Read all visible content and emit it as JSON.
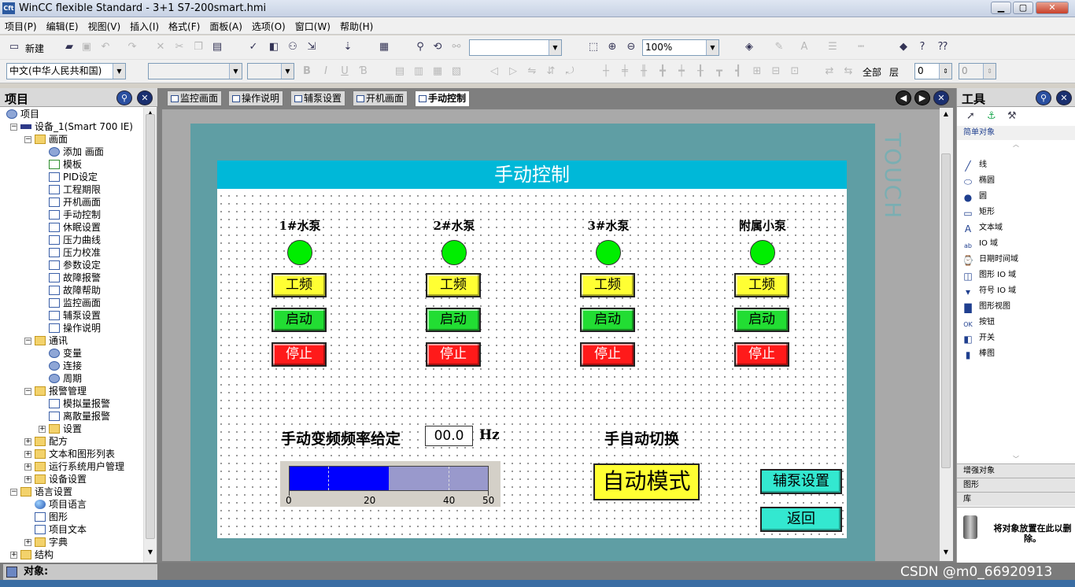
{
  "window": {
    "icon_text": "Cft",
    "title": "WinCC flexible Standard - 3+1 S7-200smart.hmi",
    "min": "▁",
    "max": "▢",
    "close": "✕"
  },
  "menu": [
    "项目(P)",
    "编辑(E)",
    "视图(V)",
    "插入(I)",
    "格式(F)",
    "面板(A)",
    "选项(O)",
    "窗口(W)",
    "帮助(H)"
  ],
  "toolbar": {
    "new_label": "新建",
    "zoom": "100%",
    "language": "中文(中华人民共和国)",
    "all_label": "全部",
    "layer_label": "层",
    "layer_value": "0",
    "layer_value2": "0"
  },
  "project_pane": {
    "title": "项目",
    "items": [
      {
        "label": "项目",
        "icon": "project-icon"
      },
      {
        "label": "设备_1(Smart 700 IE)",
        "icon": "device-icon"
      },
      {
        "label": "画面",
        "icon": "folder-icon"
      },
      {
        "label": "添加 画面",
        "icon": "add-screen-icon"
      },
      {
        "label": "模板",
        "icon": "template-icon"
      },
      {
        "label": "PID设定",
        "icon": "screen-icon"
      },
      {
        "label": "工程期限",
        "icon": "screen-icon"
      },
      {
        "label": "开机画面",
        "icon": "screen-icon"
      },
      {
        "label": "手动控制",
        "icon": "screen-icon"
      },
      {
        "label": "休眠设置",
        "icon": "screen-icon"
      },
      {
        "label": "压力曲线",
        "icon": "screen-icon"
      },
      {
        "label": "压力校准",
        "icon": "screen-icon"
      },
      {
        "label": "参数设定",
        "icon": "screen-icon"
      },
      {
        "label": "故障报警",
        "icon": "screen-icon"
      },
      {
        "label": "故障帮助",
        "icon": "screen-icon"
      },
      {
        "label": "监控画面",
        "icon": "screen-icon"
      },
      {
        "label": "辅泵设置",
        "icon": "screen-icon"
      },
      {
        "label": "操作说明",
        "icon": "screen-icon"
      },
      {
        "label": "通讯",
        "icon": "folder-icon"
      },
      {
        "label": "变量",
        "icon": "tag-icon"
      },
      {
        "label": "连接",
        "icon": "connection-icon"
      },
      {
        "label": "周期",
        "icon": "cycle-icon"
      },
      {
        "label": "报警管理",
        "icon": "folder-icon"
      },
      {
        "label": "模拟量报警",
        "icon": "analog-alarm-icon"
      },
      {
        "label": "离散量报警",
        "icon": "discrete-alarm-icon"
      },
      {
        "label": "设置",
        "icon": "folder-icon"
      },
      {
        "label": "配方",
        "icon": "folder-icon"
      },
      {
        "label": "文本和图形列表",
        "icon": "folder-icon"
      },
      {
        "label": "运行系统用户管理",
        "icon": "folder-icon"
      },
      {
        "label": "设备设置",
        "icon": "folder-icon"
      },
      {
        "label": "语言设置",
        "icon": "folder-icon"
      },
      {
        "label": "项目语言",
        "icon": "globe-icon"
      },
      {
        "label": "图形",
        "icon": "graphics-icon"
      },
      {
        "label": "项目文本",
        "icon": "text-icon"
      },
      {
        "label": "字典",
        "icon": "folder-icon"
      },
      {
        "label": "结构",
        "icon": "folder-icon"
      }
    ]
  },
  "tabs": [
    "监控画面",
    "操作说明",
    "辅泵设置",
    "开机画面",
    "手动控制"
  ],
  "active_tab": 4,
  "hmi": {
    "title": "手动控制",
    "panel_brand": "TOUCH",
    "pumps": [
      {
        "name": "1#水泵",
        "freq": "工频",
        "start": "启动",
        "stop": "停止"
      },
      {
        "name": "2#水泵",
        "freq": "工频",
        "start": "启动",
        "stop": "停止"
      },
      {
        "name": "3#水泵",
        "freq": "工频",
        "start": "启动",
        "stop": "停止"
      },
      {
        "name": "附属小泵",
        "freq": "工频",
        "start": "启动",
        "stop": "停止"
      }
    ],
    "freq_label": "手动变频频率给定",
    "freq_value": "00.0",
    "freq_unit": "Hz",
    "bar": {
      "min": 0,
      "max": 50,
      "value": 25,
      "ticks": [
        "0",
        "20",
        "40",
        "50"
      ]
    },
    "switch_label": "手自动切换",
    "mode_button": "自动模式",
    "aux_button": "辅泵设置",
    "back_button": "返回",
    "colors": {
      "title_bg": "#00b8d8",
      "lamp": "#00ee00",
      "freq_btn": "#ffff33",
      "start_btn": "#22dd33",
      "stop_btn": "#ff1a1a",
      "cyan_btn": "#33e8d0",
      "bar_fill": "#0000ff"
    }
  },
  "tools_pane": {
    "title": "工具",
    "section_simple": "简单对象",
    "items": [
      {
        "label": "线",
        "icon": "line-icon"
      },
      {
        "label": "椭圆",
        "icon": "ellipse-icon"
      },
      {
        "label": "圆",
        "icon": "circle-icon"
      },
      {
        "label": "矩形",
        "icon": "rectangle-icon"
      },
      {
        "label": "文本域",
        "icon": "text-field-icon"
      },
      {
        "label": "IO 域",
        "icon": "io-field-icon"
      },
      {
        "label": "日期时间域",
        "icon": "datetime-icon"
      },
      {
        "label": "图形 IO 域",
        "icon": "graphic-io-icon"
      },
      {
        "label": "符号 IO 域",
        "icon": "symbolic-io-icon"
      },
      {
        "label": "图形视图",
        "icon": "graphic-view-icon"
      },
      {
        "label": "按钮",
        "icon": "button-icon"
      },
      {
        "label": "开关",
        "icon": "switch-icon"
      },
      {
        "label": "棒图",
        "icon": "bar-icon"
      }
    ],
    "section_enhanced": "增强对象",
    "section_graphics": "图形",
    "section_library": "库",
    "drop_hint": "将对象放置在此以删除。"
  },
  "status": {
    "object_label": "对象:",
    "watermark": "CSDN @m0_66920913"
  }
}
